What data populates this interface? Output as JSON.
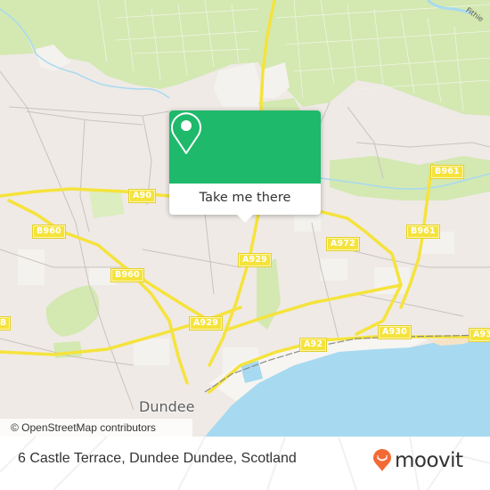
{
  "map": {
    "attribution": "© OpenStreetMap contributors",
    "place_labels": [
      {
        "id": "dundee",
        "text": "Dundee"
      }
    ],
    "river_label": "Fithie",
    "road_labels": [
      {
        "id": "a90",
        "text": "A90"
      },
      {
        "id": "b960-1",
        "text": "B960"
      },
      {
        "id": "b960-2",
        "text": "B960"
      },
      {
        "id": "a929-1",
        "text": "A929"
      },
      {
        "id": "a929-2",
        "text": "A929"
      },
      {
        "id": "a972",
        "text": "A972"
      },
      {
        "id": "b961-1",
        "text": "B961"
      },
      {
        "id": "b961-2",
        "text": "B961"
      },
      {
        "id": "a92",
        "text": "A92"
      },
      {
        "id": "a930-1",
        "text": "A930"
      },
      {
        "id": "a930-2",
        "text": "A93"
      },
      {
        "id": "edge-left",
        "text": "B"
      }
    ],
    "colors": {
      "land": "#efeae6",
      "park": "#d4e8b2",
      "water": "#a7daf0",
      "major_road": "#f5e33c",
      "minor_road": "#bdb8b4",
      "industrial": "#f6f5f2",
      "beach": "#f6e3c6"
    }
  },
  "popup": {
    "icon": "map-pin-icon",
    "button_label": "Take me there",
    "accent_color": "#1fb96b"
  },
  "footer": {
    "address": "6 Castle Terrace, Dundee Dundee, Scotland",
    "logo_text": "moovit",
    "logo_icon": "moovit-pin-icon",
    "logo_color": "#f26a35"
  }
}
